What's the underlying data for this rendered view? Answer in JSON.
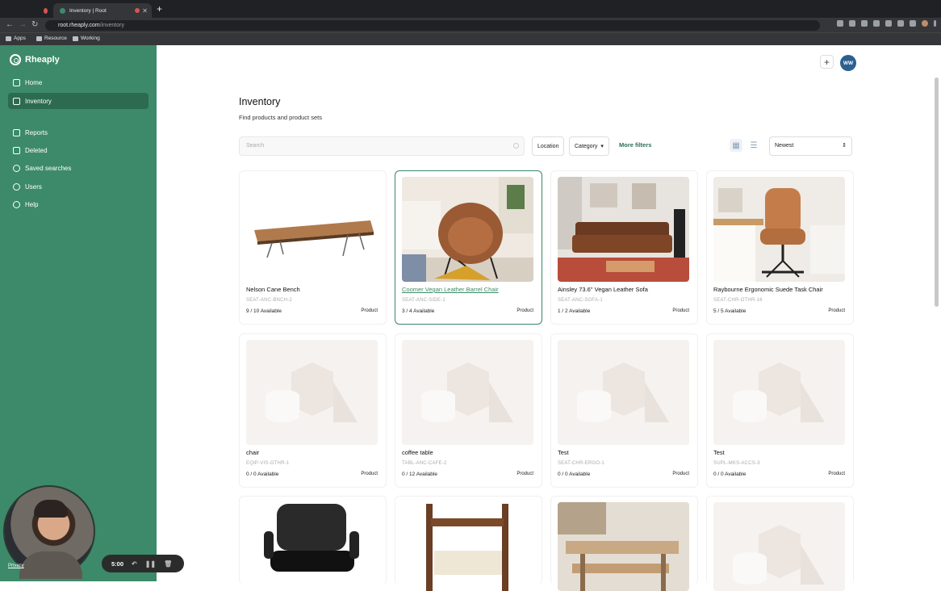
{
  "browser": {
    "tabs": [
      {
        "label": ""
      },
      {
        "label": "Inventory | Root"
      }
    ],
    "url_host": "root.rheaply.com",
    "url_path": "/inventory",
    "bookmarks": [
      "Apps",
      "Resource",
      "Working"
    ]
  },
  "sidebar": {
    "brand": "Rheaply",
    "items": [
      {
        "label": "Home",
        "icon": "home-icon"
      },
      {
        "label": "Inventory",
        "icon": "inventory-icon",
        "active": true
      },
      {
        "label": "Reports",
        "icon": "reports-icon"
      },
      {
        "label": "Deleted",
        "icon": "trash-icon"
      },
      {
        "label": "Saved searches",
        "icon": "saved-search-icon"
      },
      {
        "label": "Users",
        "icon": "users-icon"
      },
      {
        "label": "Help",
        "icon": "help-icon"
      }
    ],
    "accent": "#3c8a69"
  },
  "recorder": {
    "time": "5:00",
    "privacy": "Privacy"
  },
  "header": {
    "avatar_initials": "WW"
  },
  "page": {
    "title": "Inventory",
    "subtitle": "Find products and product sets",
    "search_placeholder": "Search",
    "filters": {
      "location": "Location",
      "category": "Category",
      "more": "More filters"
    },
    "sort": "Newest"
  },
  "products": [
    {
      "name": "Nelson Cane Bench",
      "sku": "SEAT-ANC-BNCH-2",
      "availability": "9 / 10 Available",
      "type": "Product"
    },
    {
      "name": "Coomer Vegan Leather Barrel Chair",
      "sku": "SEAT-ANC-SIDE-1",
      "availability": "3 / 4 Available",
      "type": "Product"
    },
    {
      "name": "Ainsley 73.6\" Vegan Leather Sofa",
      "sku": "SEAT-ANC-SOFA-1",
      "availability": "1 / 2 Available",
      "type": "Product"
    },
    {
      "name": "Raybourne Ergonomic Suede Task Chair",
      "sku": "SEAT-CHR-OTHR-16",
      "availability": "5 / 5 Available",
      "type": "Product"
    },
    {
      "name": "chair",
      "sku": "EQIP-VIS-OTHR-1",
      "availability": "0 / 0 Available",
      "type": "Product"
    },
    {
      "name": "coffee table",
      "sku": "TABL-ANC-CAFE-2",
      "availability": "0 / 12 Available",
      "type": "Product"
    },
    {
      "name": "Test",
      "sku": "SEAT-CHR-ERGO-1",
      "availability": "0 / 0 Available",
      "type": "Product"
    },
    {
      "name": "Test",
      "sku": "SUPL-MKS-ACCS-3",
      "availability": "0 / 0 Available",
      "type": "Product"
    }
  ]
}
